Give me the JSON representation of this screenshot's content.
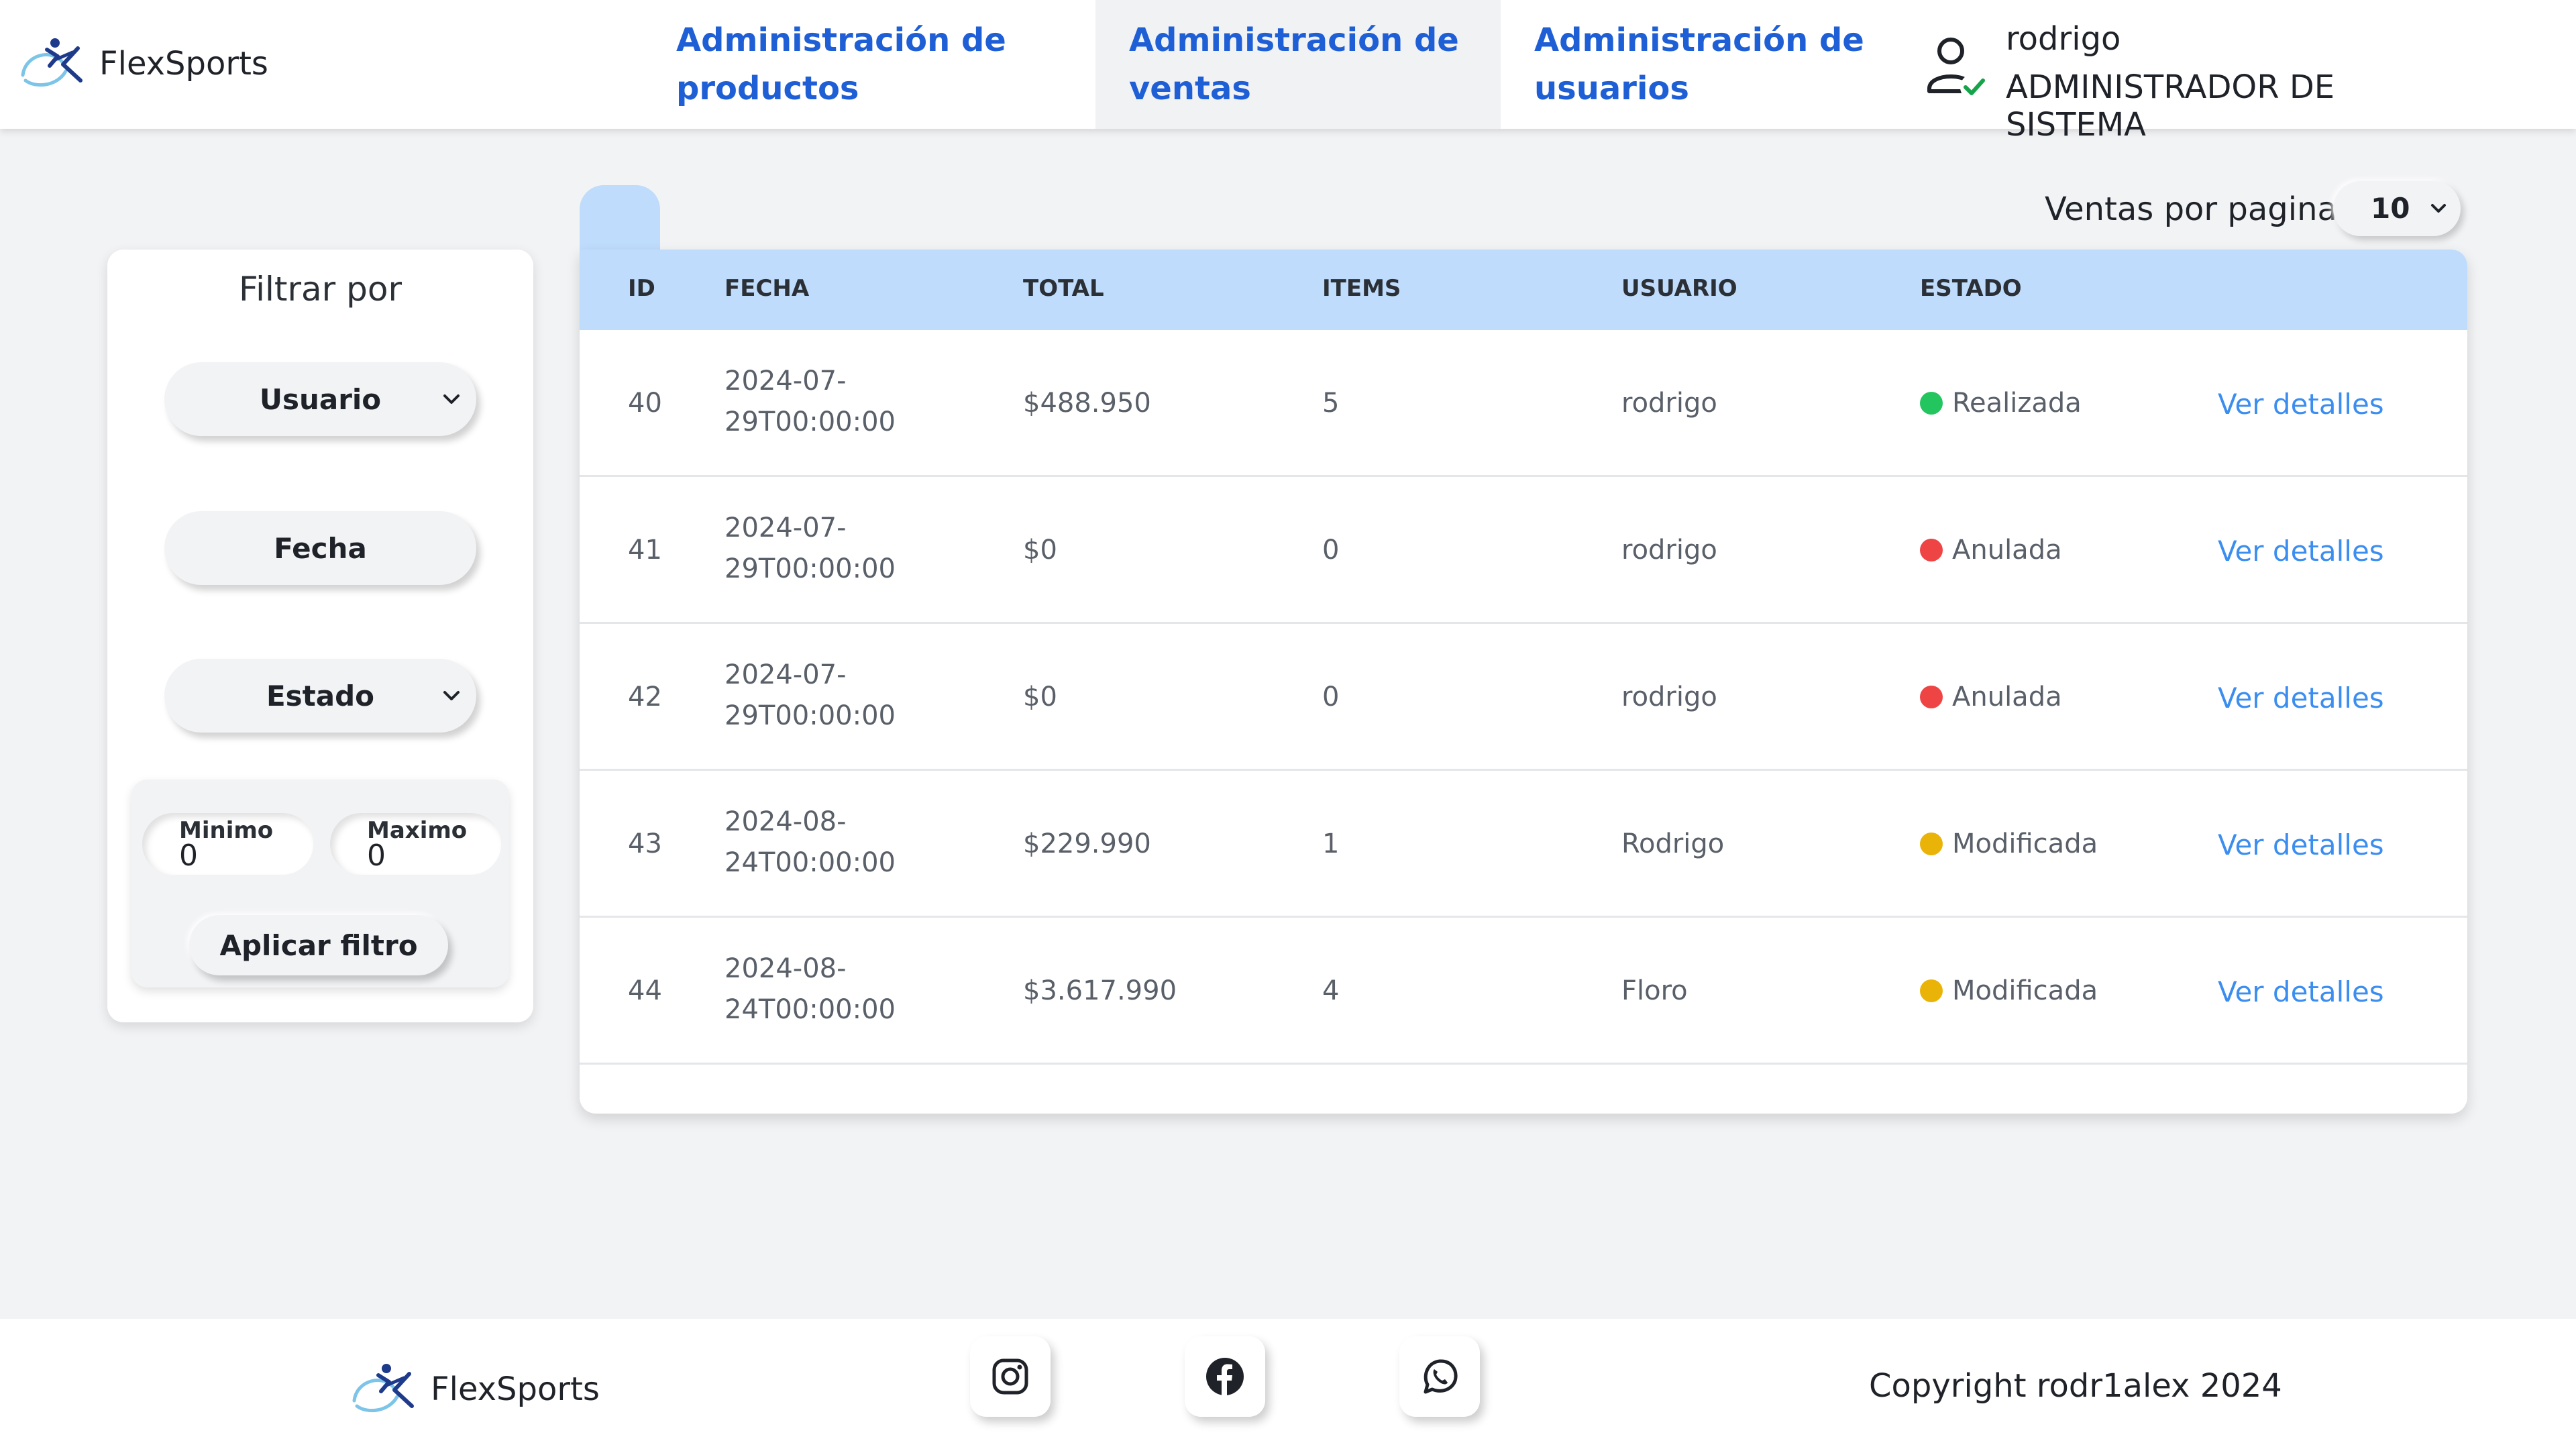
{
  "header": {
    "brand": "FlexSports",
    "nav": [
      {
        "label": "Administración de productos",
        "active": false
      },
      {
        "label": "Administración de ventas",
        "active": true
      },
      {
        "label": "Administración de usuarios",
        "active": false
      }
    ],
    "user": {
      "name": "rodrigo",
      "role": "ADMINISTRADOR DE SISTEMA",
      "icon": "user-check-icon"
    }
  },
  "filters": {
    "title": "Filtrar por",
    "user_label": "Usuario",
    "date_label": "Fecha",
    "state_label": "Estado",
    "min_label": "Minimo",
    "min_value": "0",
    "max_label": "Maximo",
    "max_value": "0",
    "apply_label": "Aplicar filtro"
  },
  "pagination": {
    "label": "Ventas por pagina:",
    "value": "10"
  },
  "table": {
    "columns": [
      "ID",
      "FECHA",
      "TOTAL",
      "ITEMS",
      "USUARIO",
      "ESTADO"
    ],
    "rows": [
      {
        "id": "40",
        "date1": "2024-07-",
        "date2": "29T00:00:00",
        "total": "$488.950",
        "items": "5",
        "user": "rodrigo",
        "status": "Realizada",
        "details": "Ver detalles"
      },
      {
        "id": "41",
        "date1": "2024-07-",
        "date2": "29T00:00:00",
        "total": "$0",
        "items": "0",
        "user": "rodrigo",
        "status": "Anulada",
        "details": "Ver detalles"
      },
      {
        "id": "42",
        "date1": "2024-07-",
        "date2": "29T00:00:00",
        "total": "$0",
        "items": "0",
        "user": "rodrigo",
        "status": "Anulada",
        "details": "Ver detalles"
      },
      {
        "id": "43",
        "date1": "2024-08-",
        "date2": "24T00:00:00",
        "total": "$229.990",
        "items": "1",
        "user": "Rodrigo",
        "status": "Modificada",
        "details": "Ver detalles"
      },
      {
        "id": "44",
        "date1": "2024-08-",
        "date2": "24T00:00:00",
        "total": "$3.617.990",
        "items": "4",
        "user": "Floro",
        "status": "Modificada",
        "details": "Ver detalles"
      }
    ]
  },
  "status_colors": {
    "Realizada": "#22c55e",
    "Anulada": "#ef4444",
    "Modificada": "#eab308"
  },
  "colors": {
    "accent": "#1f5fd6",
    "header_row": "#bfdcfc",
    "link": "#3b8ef0"
  },
  "footer": {
    "brand": "FlexSports",
    "social": [
      "instagram-icon",
      "facebook-icon",
      "whatsapp-icon"
    ],
    "copyright": "Copyright rodr1alex 2024"
  }
}
